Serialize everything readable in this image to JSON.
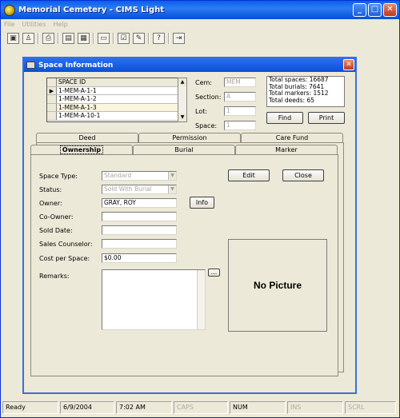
{
  "app": {
    "title": "Memorial Cemetery - CIMS Light"
  },
  "menu": [
    {
      "label": "File"
    },
    {
      "label": "Utilities"
    },
    {
      "label": "Help"
    }
  ],
  "dialog": {
    "title": "Space Information",
    "grid": {
      "header": "SPACE ID",
      "rows": [
        "1-MEM-A-1-1",
        "1-MEM-A-1-2",
        "1-MEM-A-1-3",
        "1-MEM-A-10-1"
      ]
    },
    "location": {
      "cem_label": "Cem:",
      "cem_value": "MEM",
      "section_label": "Section:",
      "section_value": "A",
      "lot_label": "Lot:",
      "lot_value": "1",
      "space_label": "Space:",
      "space_value": "1"
    },
    "totals": {
      "spaces": "Total spaces: 16687",
      "burials": "Total burials: 7641",
      "markers": "Total markers: 1512",
      "deeds": "Total deeds: 65"
    },
    "buttons": {
      "find": "Find",
      "print": "Print",
      "edit": "Edit",
      "close": "Close",
      "info": "Info",
      "remarks_more": "..."
    },
    "tabs_back": [
      "Deed",
      "Permission",
      "Care Fund"
    ],
    "tabs_front": [
      "Ownership",
      "Burial",
      "Marker"
    ],
    "active_tab": "Ownership",
    "form": {
      "space_type_label": "Space Type:",
      "space_type_value": "Standard",
      "status_label": "Status:",
      "status_value": "Sold With Burial",
      "owner_label": "Owner:",
      "owner_value": "GRAY, ROY",
      "co_owner_label": "Co-Owner:",
      "co_owner_value": "",
      "sold_date_label": "Sold Date:",
      "sold_date_value": "",
      "sales_counselor_label": "Sales Counselor:",
      "sales_counselor_value": "",
      "cost_label": "Cost per Space:",
      "cost_value": "$0.00",
      "remarks_label": "Remarks:",
      "remarks_value": ""
    },
    "picture_text": "No Picture"
  },
  "status": {
    "state": "Ready",
    "date": "6/9/2004",
    "time": "7:02 AM",
    "caps": "CAPS",
    "num": "NUM",
    "ins": "INS",
    "scrl": "SCRL"
  },
  "colors": {
    "titlebar": "#0a5fe8",
    "dialog_bg": "#ece9d8",
    "close_button": "#c43a1c"
  }
}
